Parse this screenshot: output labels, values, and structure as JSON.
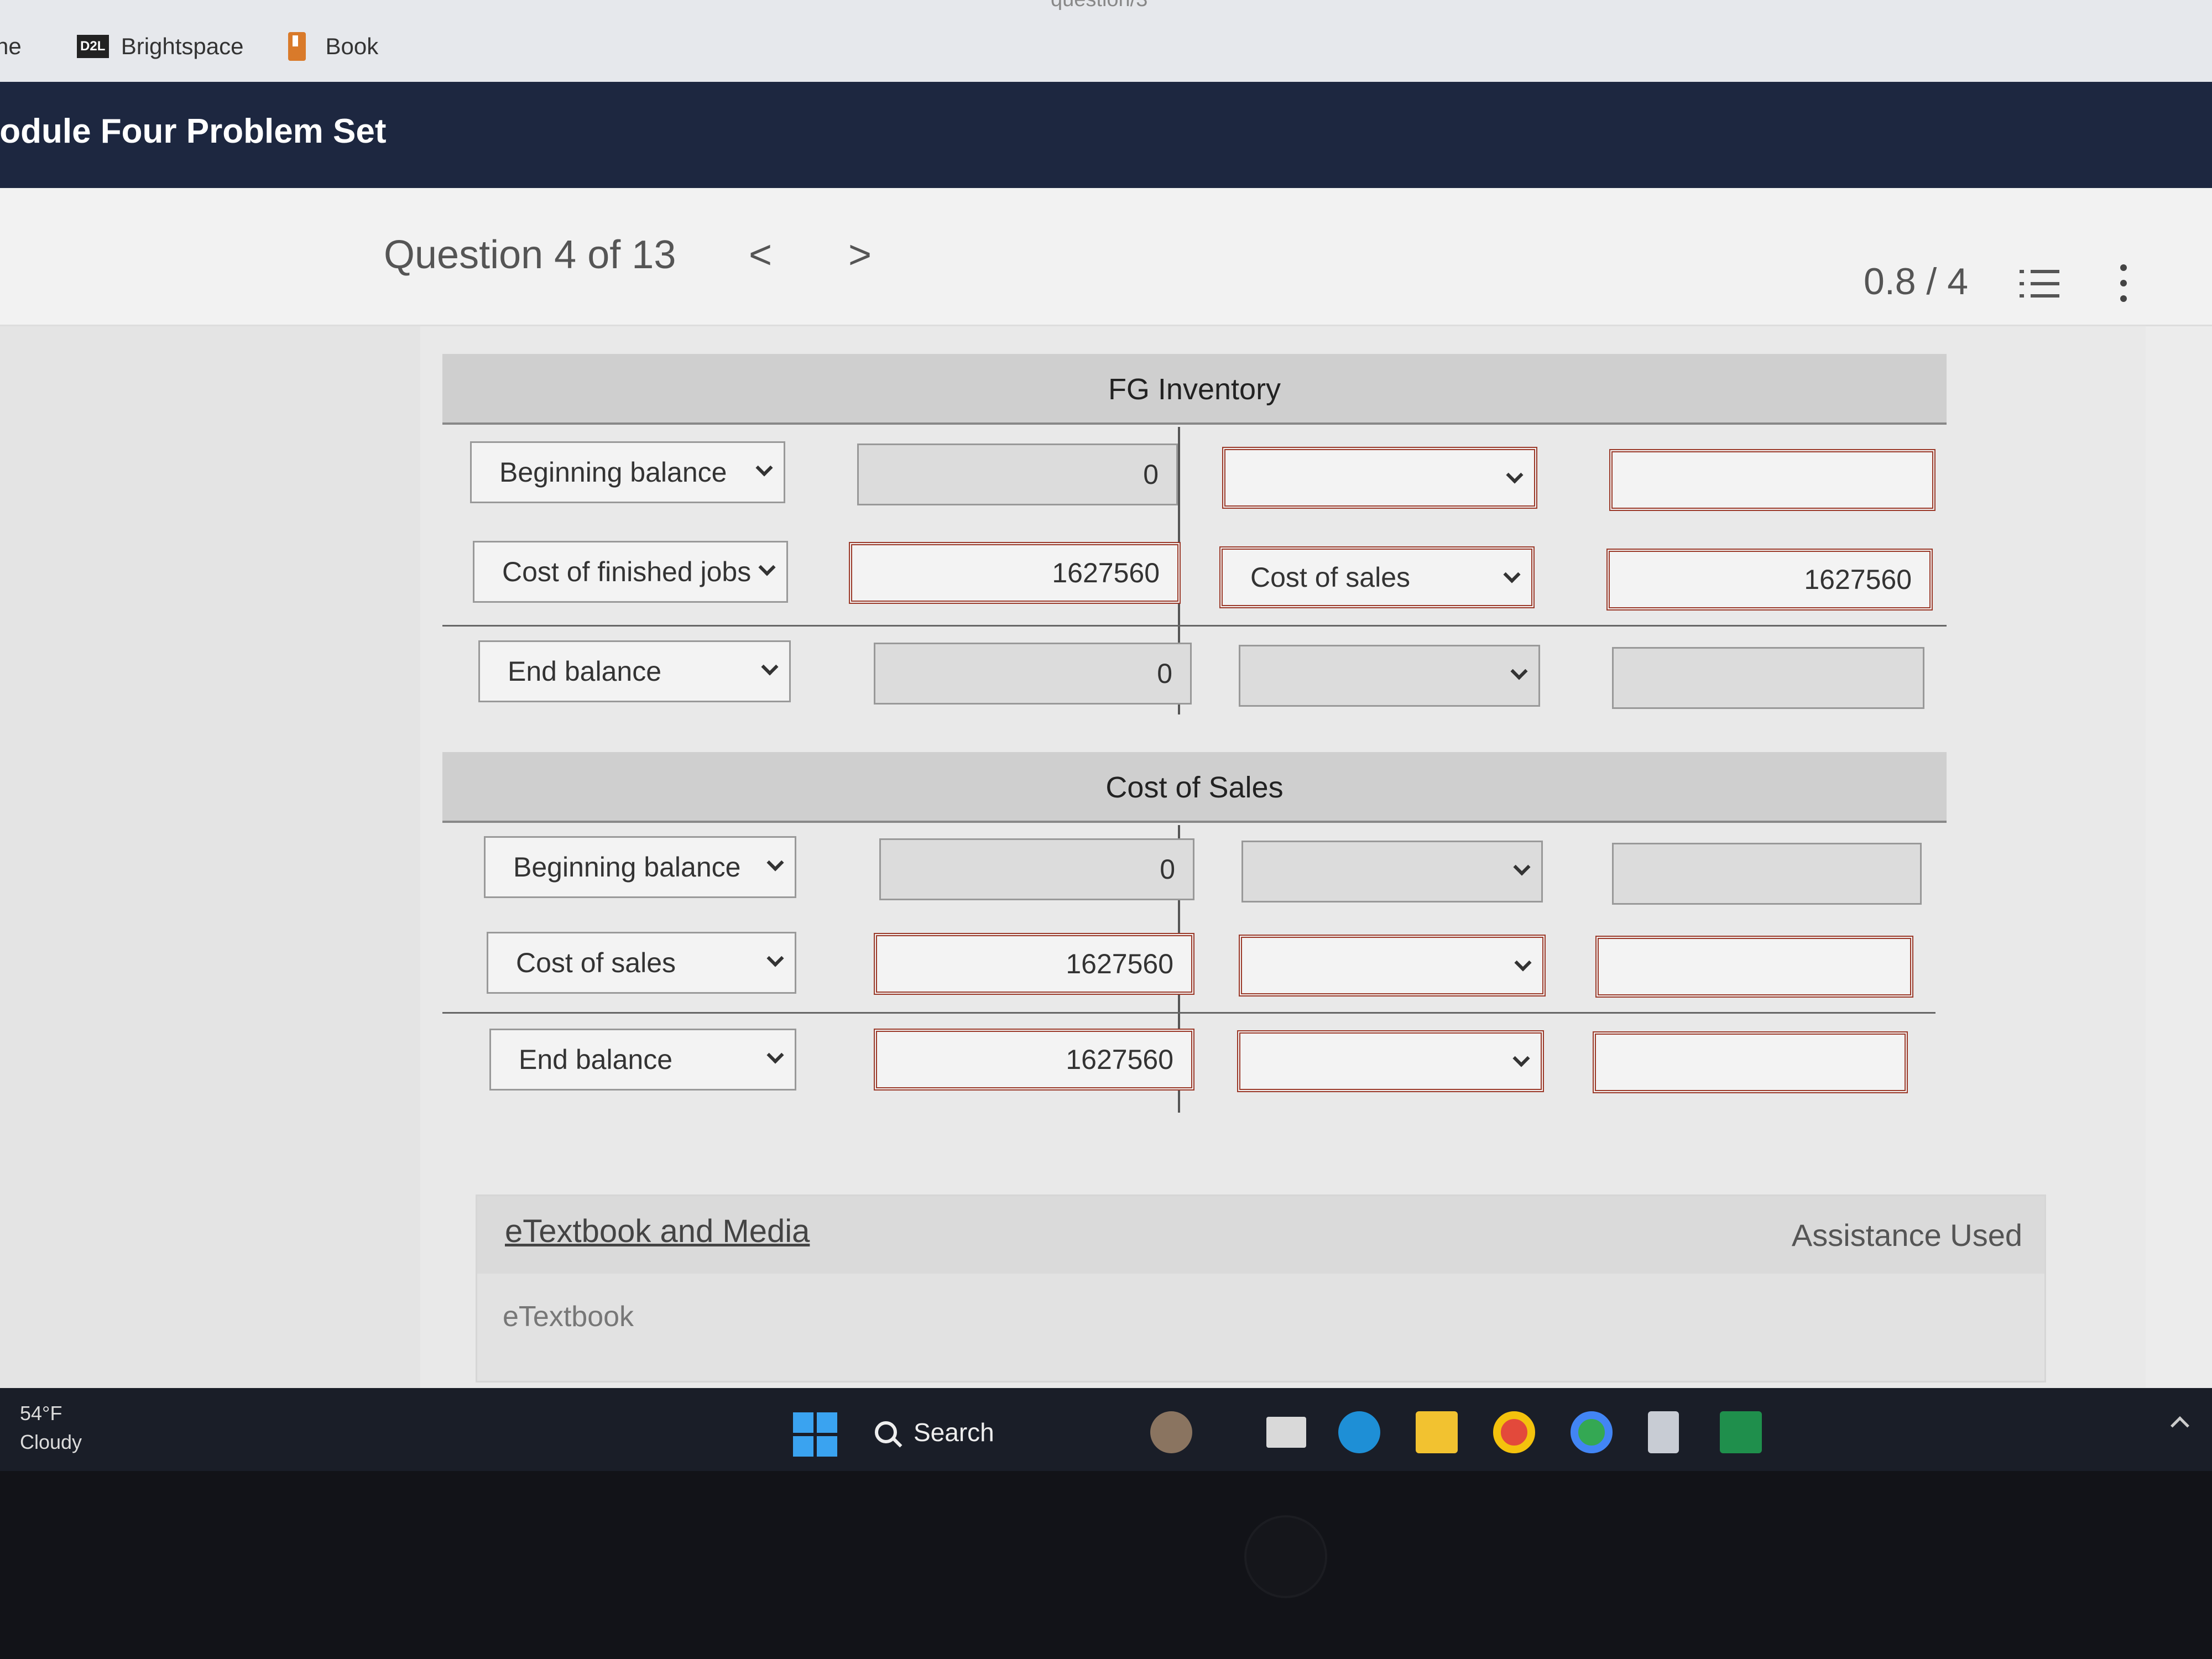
{
  "browser": {
    "url_fragment": "question/3",
    "bookmarks": [
      {
        "label": "ne",
        "icon": "home-icon"
      },
      {
        "label": "Brightspace",
        "icon": "d2l-logo"
      },
      {
        "label": "Book",
        "icon": "bookmark-icon"
      }
    ],
    "d2l_badge": "D2L"
  },
  "header": {
    "title": "lodule Four Problem Set"
  },
  "question_nav": {
    "title": "Question 4 of 13",
    "prev_label": "<",
    "next_label": ">",
    "score": "0.8 / 4"
  },
  "fg_inventory": {
    "title": "FG Inventory",
    "rows": [
      {
        "debit_account": "Beginning balance",
        "debit_amount": "0",
        "credit_account": "",
        "credit_amount": ""
      },
      {
        "debit_account": "Cost of finished jobs",
        "debit_amount": "1627560",
        "credit_account": "Cost of sales",
        "credit_amount": "1627560"
      },
      {
        "debit_account": "End balance",
        "debit_amount": "0",
        "credit_account": "",
        "credit_amount": ""
      }
    ]
  },
  "cost_of_sales": {
    "title": "Cost of Sales",
    "rows": [
      {
        "debit_account": "Beginning balance",
        "debit_amount": "0",
        "credit_account": "",
        "credit_amount": ""
      },
      {
        "debit_account": "Cost of sales",
        "debit_amount": "1627560",
        "credit_account": "",
        "credit_amount": ""
      },
      {
        "debit_account": "End balance",
        "debit_amount": "1627560",
        "credit_account": "",
        "credit_amount": ""
      }
    ]
  },
  "etextbook": {
    "link": "eTextbook and Media",
    "assistance": "Assistance Used",
    "tab": "eTextbook"
  },
  "taskbar": {
    "temperature": "54°F",
    "condition": "Cloudy",
    "search_label": "Search"
  },
  "colors": {
    "header_bg": "#1d2740",
    "error_border": "#9b3a2a",
    "taskbar_bg": "#1a1e28",
    "windows_blue": "#3aa3f0"
  }
}
